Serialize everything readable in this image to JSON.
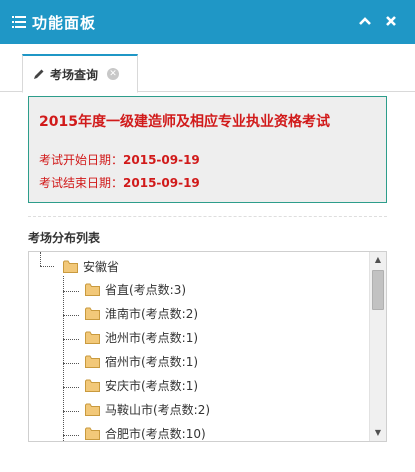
{
  "header": {
    "title": "功能面板",
    "collapse_icon": "chevron-up-icon",
    "close_icon": "close-icon"
  },
  "tab": {
    "label": "考场查询",
    "icon": "pencil-icon"
  },
  "exam": {
    "title": "2015年度一级建造师及相应专业执业资格考试",
    "start_label": "考试开始日期：",
    "start_value": "2015-09-19",
    "end_label": "考试结束日期：",
    "end_value": "2015-09-19"
  },
  "tree": {
    "section_title": "考场分布列表",
    "root": {
      "label": "安徽省"
    },
    "children": [
      {
        "label": "省直(考点数:3)"
      },
      {
        "label": "淮南市(考点数:2)"
      },
      {
        "label": "池州市(考点数:1)"
      },
      {
        "label": "宿州市(考点数:1)"
      },
      {
        "label": "安庆市(考点数:1)"
      },
      {
        "label": "马鞍山市(考点数:2)"
      },
      {
        "label": "合肥市(考点数:10)"
      }
    ]
  },
  "colors": {
    "header_bg": "#1f97c6",
    "exam_text": "#d11a1a",
    "exam_border": "#2d9d8b",
    "folder": "#f2c879"
  }
}
